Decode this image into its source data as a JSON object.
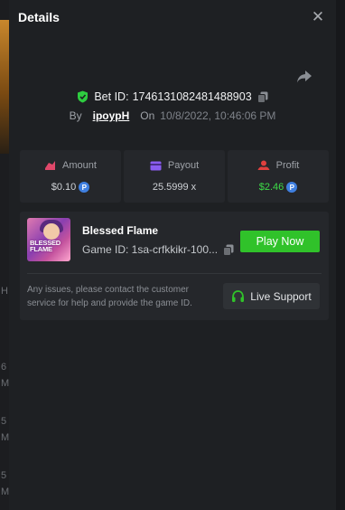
{
  "panel": {
    "title": "Details"
  },
  "bet": {
    "id_label": "Bet ID:",
    "id_value": "1746131082481488903",
    "by_label": "By",
    "username": "ipoypH",
    "on_label": "On",
    "date": "10/8/2022, 10:46:06 PM"
  },
  "stats": {
    "amount": {
      "label": "Amount",
      "value": "$0.10"
    },
    "payout": {
      "label": "Payout",
      "value": "25.5999 x"
    },
    "profit": {
      "label": "Profit",
      "value": "$2.46"
    }
  },
  "game": {
    "name": "Blessed Flame",
    "id_text": "Game ID: 1sa-crfkkikr-100...",
    "play_label": "Play Now",
    "help_text": "Any issues, please contact the customer service for help and provide the game ID.",
    "support_label": "Live Support",
    "thumb_title": "BLESSED FLAME"
  },
  "background": {
    "letters": [
      "H",
      "6",
      "M",
      "5",
      "M",
      "5",
      "M"
    ]
  },
  "colors": {
    "accent_green": "#30c22a",
    "profit_green": "#3ddc48",
    "amount_icon": "#e0486a",
    "payout_icon": "#8a5cf0",
    "profit_icon": "#e0403e",
    "coin_blue": "#3f7fe0",
    "shield_green": "#2ecc40"
  }
}
